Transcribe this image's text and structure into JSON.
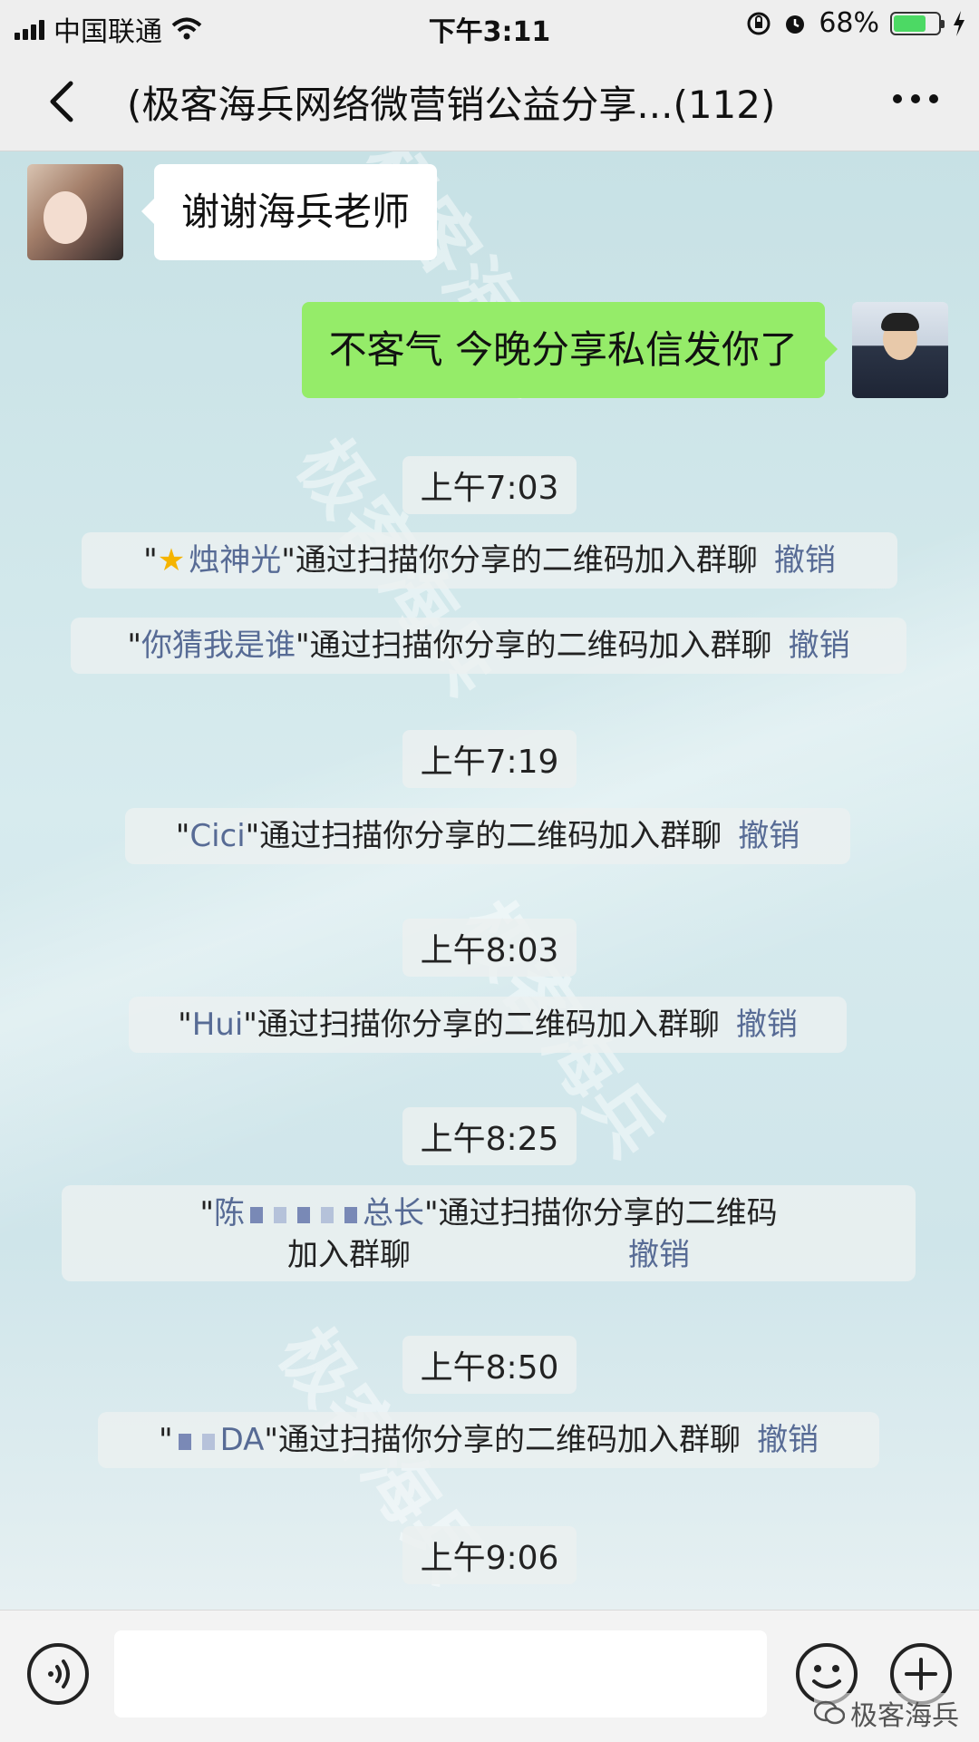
{
  "status_bar": {
    "carrier": "中国联通",
    "time": "下午3:11",
    "battery": "68%",
    "battery_level": 0.68
  },
  "nav": {
    "title": "(极客海兵网络微营销公益分享...(112)"
  },
  "watermark": "极客海兵",
  "messages": {
    "left_text": "谢谢海兵老师",
    "right_text": "不客气  今晚分享私信发你了"
  },
  "join_suffix": "\"通过扫描你分享的二维码加入群聊",
  "revoke_label": "撤销",
  "events": [
    {
      "time": "上午7:03"
    },
    {
      "time": "上午7:19"
    },
    {
      "time": "上午8:03"
    },
    {
      "time": "上午8:25"
    },
    {
      "time": "上午8:50"
    },
    {
      "time": "上午9:06"
    }
  ],
  "joins": [
    {
      "name": "烛神光"
    },
    {
      "name": "你猜我是谁"
    },
    {
      "name": "Cici"
    },
    {
      "name": "Hui"
    },
    {
      "name_start": "陈",
      "name_end": "总长",
      "suffix_line1": "\"通过扫描你分享的二维码",
      "suffix_line2": "加入群聊"
    },
    {
      "name_end": "DA"
    }
  ],
  "brand": "极客海兵",
  "colors": {
    "self_bubble": "#95ec69",
    "other_bubble": "#ffffff",
    "link": "#576b95"
  }
}
